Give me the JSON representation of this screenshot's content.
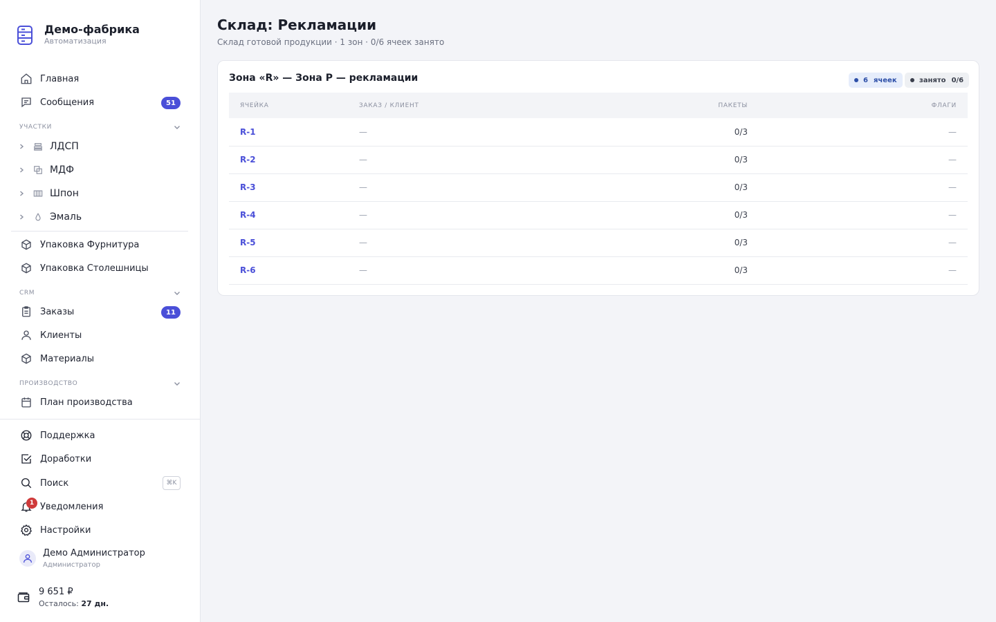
{
  "brand": {
    "title": "Демо-фабрика",
    "subtitle": "Автоматизация"
  },
  "nav": {
    "home": "Главная",
    "messages": "Сообщения",
    "messages_badge": "51"
  },
  "sections": {
    "areas": "УЧАСТКИ",
    "crm": "CRM",
    "production": "ПРОИЗВОДСТВО"
  },
  "areas": [
    {
      "label": "ЛДСП",
      "icon": "layers-icon"
    },
    {
      "label": "МДФ",
      "icon": "copy-icon"
    },
    {
      "label": "Шпон",
      "icon": "veneer-icon"
    },
    {
      "label": "Эмаль",
      "icon": "drop-icon"
    }
  ],
  "packaging": {
    "fittings": "Упаковка Фурнитура",
    "countertops": "Упаковка Столешницы"
  },
  "crm": {
    "orders": "Заказы",
    "orders_badge": "11",
    "clients": "Клиенты",
    "materials": "Материалы"
  },
  "production": {
    "plan": "План производства"
  },
  "bottom": {
    "support": "Поддержка",
    "improvements": "Доработки",
    "search": "Поиск",
    "search_kbd": "⌘K",
    "notifications": "Уведомления",
    "notifications_count": "1",
    "settings": "Настройки"
  },
  "user": {
    "name": "Демо Администратор",
    "role": "Администратор"
  },
  "wallet": {
    "amount": "9 651 ₽",
    "left_label": "Осталось:",
    "left_value": "27 дн."
  },
  "page": {
    "title": "Склад: Рекламации",
    "subtitle": "Склад готовой продукции · 1 зон · 0/6 ячеек занято"
  },
  "zone": {
    "title": "Зона «R» — Зона Р — рекламации",
    "cells_count": "6",
    "cells_label": "ячеек",
    "occupied_label": "занято",
    "occupied_value": "0/6"
  },
  "table": {
    "headers": [
      "ЯЧЕЙКА",
      "ЗАКАЗ / КЛИЕНТ",
      "ПАКЕТЫ",
      "ФЛАГИ"
    ],
    "rows": [
      {
        "cell": "R-1",
        "order": "—",
        "packages": "0/3",
        "flags": "—"
      },
      {
        "cell": "R-2",
        "order": "—",
        "packages": "0/3",
        "flags": "—"
      },
      {
        "cell": "R-3",
        "order": "—",
        "packages": "0/3",
        "flags": "—"
      },
      {
        "cell": "R-4",
        "order": "—",
        "packages": "0/3",
        "flags": "—"
      },
      {
        "cell": "R-5",
        "order": "—",
        "packages": "0/3",
        "flags": "—"
      },
      {
        "cell": "R-6",
        "order": "—",
        "packages": "0/3",
        "flags": "—"
      }
    ]
  },
  "colors": {
    "accent": "#4a4fd8",
    "danger": "#cf3a3a"
  }
}
